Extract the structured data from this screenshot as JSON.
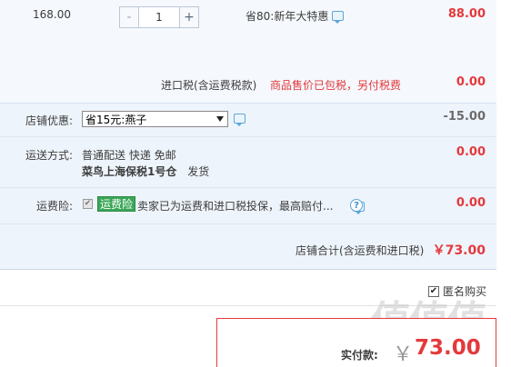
{
  "item": {
    "price": "168.00",
    "quantity": "1",
    "minus_label": "-",
    "plus_label": "+",
    "promo": "省80:新年大特惠",
    "subtotal": "88.00"
  },
  "import_tax": {
    "label": "进口税(含运费税款)",
    "note": "商品售价已包税，另付税费",
    "value": "0.00"
  },
  "shop": {
    "coupon": {
      "label": "店铺优惠:",
      "selected": "省15元:燕子",
      "value": "-15.00"
    },
    "shipping": {
      "label": "运送方式:",
      "line1": "普通配送 快递 免邮",
      "warehouse": "菜鸟上海保税1号仓",
      "suffix": "发货",
      "value": "0.00"
    },
    "insurance": {
      "label": "运费险:",
      "tag": "运费险",
      "description": "卖家已为运费和进口税投保，最高赔付...",
      "help": "?",
      "value": "0.00"
    },
    "total": {
      "label": "店铺合计(含运费和进口税)",
      "value": "￥73.00"
    }
  },
  "anonymous": {
    "label": "匿名购买",
    "checked": true
  },
  "payment": {
    "label": "实付款:",
    "currency": "￥",
    "amount": "73.00"
  },
  "watermark": "值值值",
  "colors": {
    "accent": "#e4393c",
    "panel": "#eef4fb",
    "tag_green": "#3aa657"
  }
}
